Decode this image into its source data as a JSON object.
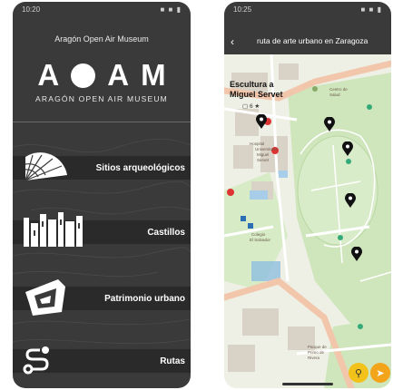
{
  "left": {
    "status_time": "10:20",
    "status_icons": "■ ■ ▮",
    "title": "Aragón Open Air Museum",
    "logo_letters": [
      "A",
      "A",
      "M"
    ],
    "logo_subtitle": "ARAGÓN OPEN AIR MUSEUM",
    "menu": [
      {
        "label": "Sitios arqueológicos",
        "icon": "archaeology-icon"
      },
      {
        "label": "Castillos",
        "icon": "castle-icon"
      },
      {
        "label": "Patrimonio urbano",
        "icon": "urban-heritage-icon"
      },
      {
        "label": "Rutas",
        "icon": "route-icon"
      }
    ]
  },
  "right": {
    "status_time": "10:25",
    "back_icon": "‹",
    "title": "ruta de arte urbano en Zaragoza",
    "poi_title_line1": "Escultura a",
    "poi_title_line2": "Miguel Servet",
    "poi_meta": "▢ 6 ★",
    "search_icon": "⚲",
    "locate_icon": "➤"
  },
  "colors": {
    "left_background": "#3a3a3a",
    "band": "#2a2a2a",
    "map_background": "#e8ece0",
    "park_green": "#c8e3b8",
    "road": "#f3c3a8",
    "fab_yellow": "#f2c21a"
  }
}
